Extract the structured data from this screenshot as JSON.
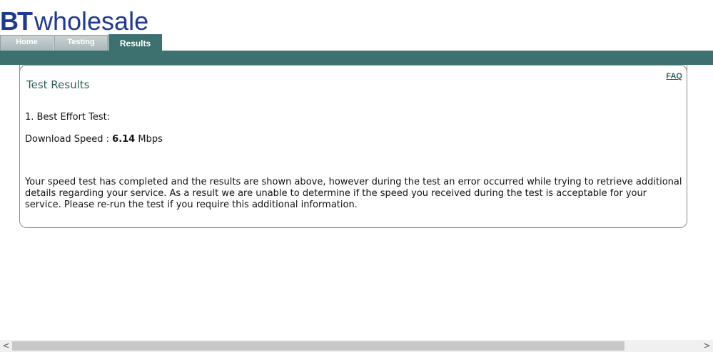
{
  "brand": {
    "logo_bt": "BT",
    "logo_word": "wholesale"
  },
  "tabs": [
    {
      "label": "Home",
      "active": false
    },
    {
      "label": "Testing",
      "active": false
    },
    {
      "label": "Results",
      "active": true
    }
  ],
  "panel": {
    "faq_label": "FAQ",
    "heading": "Test Results",
    "test_title": "1. Best Effort Test:",
    "download_label": "Download Speed : ",
    "download_value": "6.14",
    "download_unit": " Mbps",
    "message": "Your speed test has completed and the results are shown above, however during the test an error occurred while trying to retrieve additional details regarding your service. As a result we are unable to determine if the speed you received during the test is acceptable for your service. Please re-run the test if you require this additional information."
  },
  "scrollbar": {
    "left_arrow": "<",
    "right_arrow": ">"
  },
  "colors": {
    "brand_blue": "#1f3a93",
    "teal": "#3c7170"
  }
}
